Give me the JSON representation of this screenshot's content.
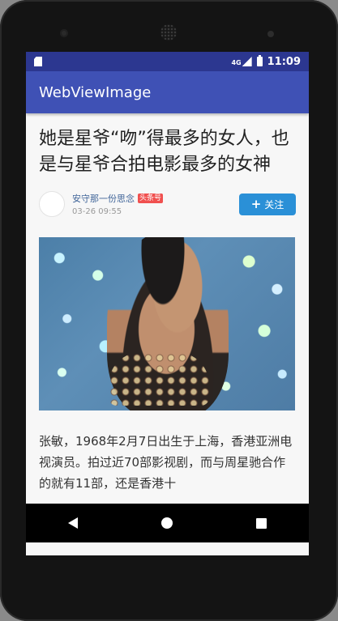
{
  "status_bar": {
    "time": "11:09",
    "signal_label": "4G",
    "icons": [
      "sd-card-icon",
      "signal-icon",
      "battery-icon"
    ]
  },
  "app_bar": {
    "title": "WebViewImage"
  },
  "article": {
    "title": "她是星爷“吻”得最多的女人，也是与星爷合拍电影最多的女神",
    "author_name": "安守那一份思念",
    "author_badge": "头条号",
    "post_time": "03-26 09:55",
    "follow_label": "关注",
    "body_text": "张敏，1968年2月7日出生于上海，香港亚洲电视演员。拍过近70部影视剧，而与周星驰合作的就有11部，还是香港十"
  },
  "navigation": {
    "buttons": [
      "back-icon",
      "home-icon",
      "recent-apps-icon"
    ]
  },
  "colors": {
    "status_bar": "#2c3790",
    "app_bar": "#3f51b5",
    "follow_button": "#2a90d7",
    "badge": "#f0504f"
  }
}
